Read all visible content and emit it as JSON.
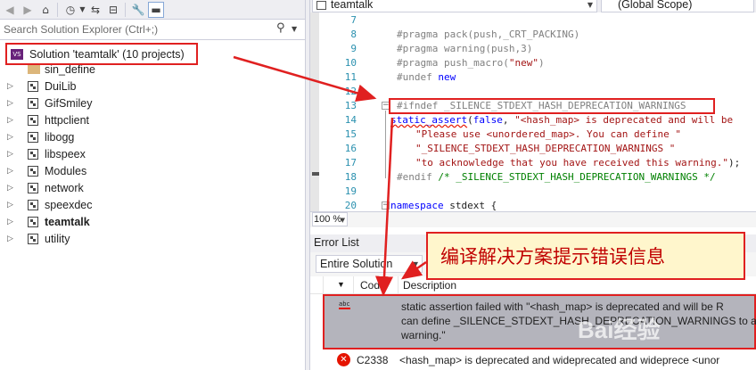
{
  "solution_explorer": {
    "search_placeholder": "Search Solution Explorer (Ctrl+;)",
    "solution_label": "Solution 'teamtalk' (10 projects)",
    "items": [
      {
        "label": "sin_define",
        "type": "folder",
        "bold": false
      },
      {
        "label": "DuiLib",
        "type": "project",
        "bold": false
      },
      {
        "label": "GifSmiley",
        "type": "project",
        "bold": false
      },
      {
        "label": "httpclient",
        "type": "project",
        "bold": false
      },
      {
        "label": "libogg",
        "type": "project",
        "bold": false
      },
      {
        "label": "libspeex",
        "type": "project",
        "bold": false
      },
      {
        "label": "Modules",
        "type": "project",
        "bold": false
      },
      {
        "label": "network",
        "type": "project",
        "bold": false
      },
      {
        "label": "speexdec",
        "type": "project",
        "bold": false
      },
      {
        "label": "teamtalk",
        "type": "project",
        "bold": true
      },
      {
        "label": "utility",
        "type": "project",
        "bold": false
      }
    ]
  },
  "editor": {
    "project_combo": "teamtalk",
    "scope_combo": "(Global Scope)",
    "zoom": "100 %",
    "line_numbers": [
      "7",
      "8",
      "9",
      "10",
      "11",
      "12",
      "13",
      "14",
      "15",
      "16",
      "17",
      "18",
      "19",
      "20"
    ],
    "lines": {
      "l8": "#pragma pack(push,_CRT_PACKING)",
      "l9": "#pragma warning(push,3)",
      "l10a": "#pragma push_macro(",
      "l10b": "\"new\"",
      "l10c": ")",
      "l11a": "#undef ",
      "l11b": "new",
      "l13": "#ifndef _SILENCE_STDEXT_HASH_DEPRECATION_WARNINGS",
      "l14a": "static_assert",
      "l14b": "(",
      "l14c": "false",
      "l14d": ", ",
      "l14e": "\"<hash_map> is deprecated and will be",
      "l15": "\"Please use <unordered_map>. You can define \"",
      "l16": "\"_SILENCE_STDEXT_HASH_DEPRECATION_WARNINGS \"",
      "l17a": "\"to acknowledge that you have received this warning.\"",
      "l17b": ");",
      "l18a": "#endif ",
      "l18b": "/* _SILENCE_STDEXT_HASH_DEPRECATION_WARNINGS */",
      "l20a": "namespace",
      "l20b": " stdext {"
    }
  },
  "error_list": {
    "title": "Error List",
    "scope": "Entire Solution",
    "col_code": "Code",
    "col_description": "Description",
    "rows": [
      {
        "icon": "abc",
        "code": "",
        "line1": "static assertion failed with \"<hash_map> is deprecated and will be R",
        "line2": "can define _SILENCE_STDEXT_HASH_DEPRECATION_WARNINGS to ac",
        "line3": "warning.\""
      },
      {
        "icon": "error-icon",
        "code": "C2338",
        "description": "<hash_map> is deprecated and wideprecated and wideprece <unor"
      }
    ]
  },
  "annotation": {
    "callout_text": "编译解决方案提示错误信息",
    "border_color": "#e02020",
    "text_color": "#c00000"
  },
  "watermark": "Bai经验"
}
